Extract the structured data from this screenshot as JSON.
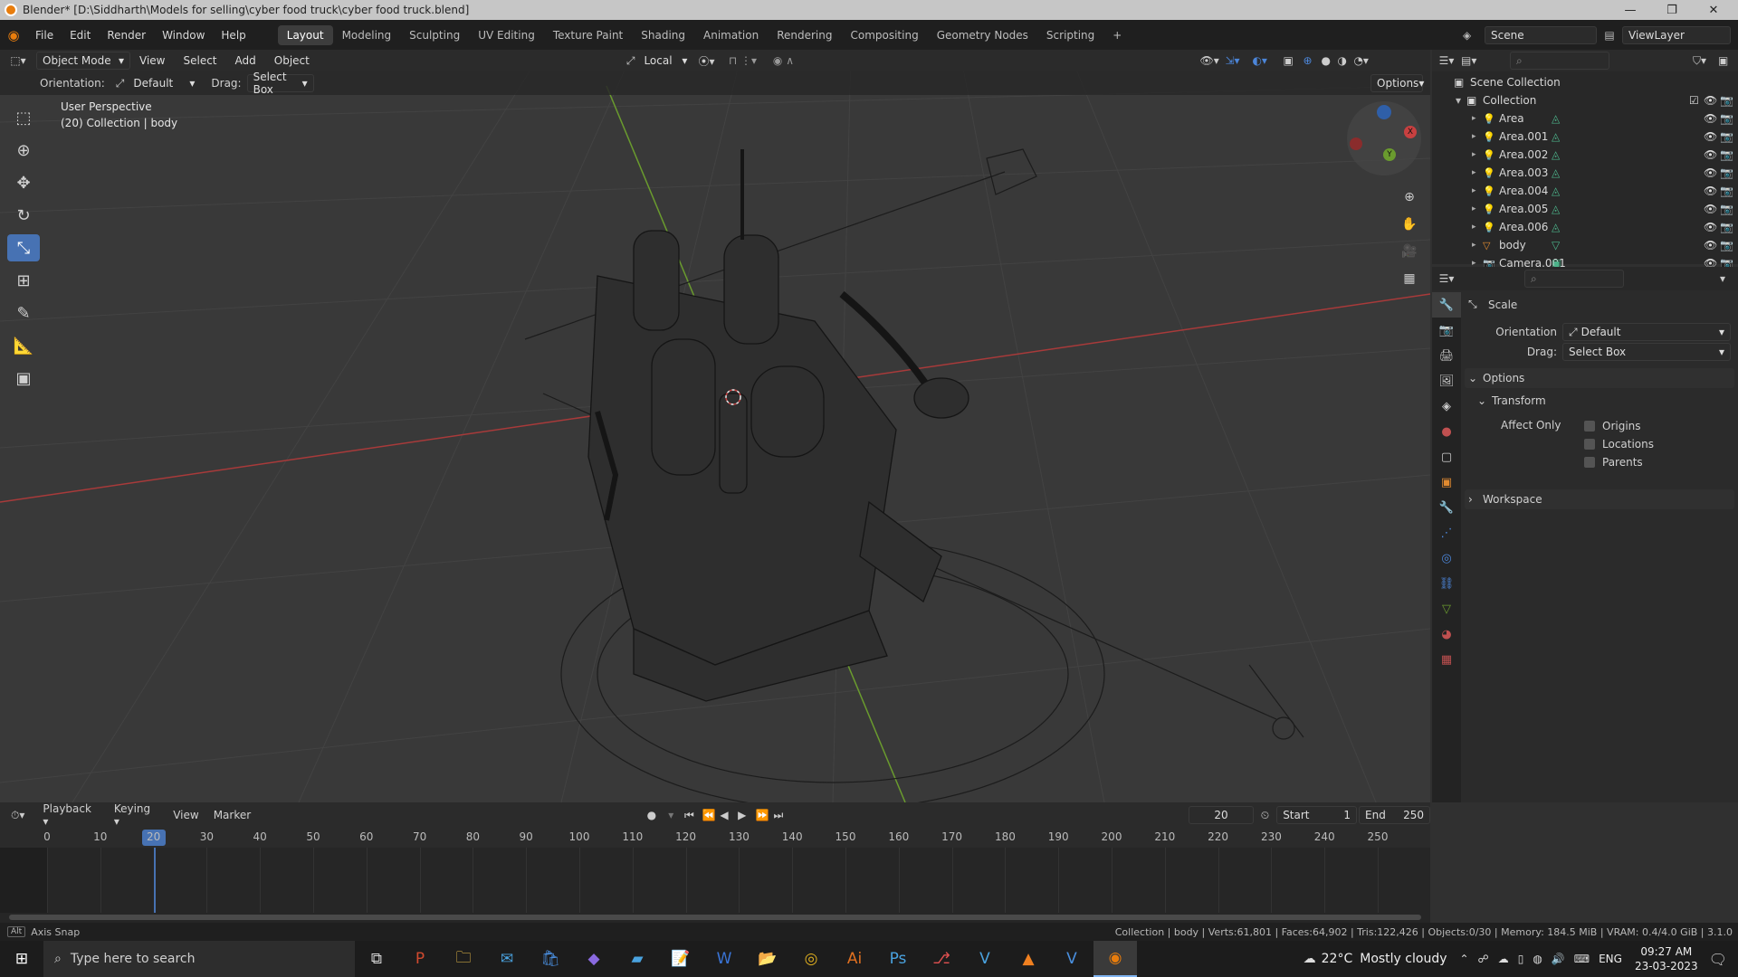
{
  "window": {
    "title": "Blender* [D:\\Siddharth\\Models for selling\\cyber food truck\\cyber food truck.blend]",
    "minimize": "—",
    "restore": "❐",
    "close": "✕"
  },
  "menu": [
    "File",
    "Edit",
    "Render",
    "Window",
    "Help"
  ],
  "workspaces": [
    "Layout",
    "Modeling",
    "Sculpting",
    "UV Editing",
    "Texture Paint",
    "Shading",
    "Animation",
    "Rendering",
    "Compositing",
    "Geometry Nodes",
    "Scripting",
    "+"
  ],
  "scene": {
    "name": "Scene",
    "view_layer": "ViewLayer"
  },
  "viewport_header": {
    "mode": "Object Mode",
    "menus": [
      "View",
      "Select",
      "Add",
      "Object"
    ],
    "transform_space": "Local",
    "options_label": "Options"
  },
  "tool_settings": {
    "orientation_label": "Orientation:",
    "orientation_value": "Default",
    "drag_label": "Drag:",
    "drag_value": "Select Box"
  },
  "hud": {
    "line1": "User Perspective",
    "line2": "(20) Collection | body"
  },
  "outliner": {
    "root": "Scene Collection",
    "collection": "Collection",
    "items": [
      {
        "name": "Area",
        "type": "light"
      },
      {
        "name": "Area.001",
        "type": "light"
      },
      {
        "name": "Area.002",
        "type": "light"
      },
      {
        "name": "Area.003",
        "type": "light"
      },
      {
        "name": "Area.004",
        "type": "light"
      },
      {
        "name": "Area.005",
        "type": "light"
      },
      {
        "name": "Area.006",
        "type": "light"
      },
      {
        "name": "body",
        "type": "mesh"
      },
      {
        "name": "Camera.001",
        "type": "camera"
      }
    ]
  },
  "properties": {
    "tool_name": "Scale",
    "orientation_label": "Orientation",
    "orientation_value": "Default",
    "drag_label": "Drag:",
    "drag_value": "Select Box",
    "options_panel": "Options",
    "transform_panel": "Transform",
    "affect_only_label": "Affect Only",
    "affect_only": [
      {
        "label": "Origins",
        "checked": false
      },
      {
        "label": "Locations",
        "checked": false
      },
      {
        "label": "Parents",
        "checked": false
      }
    ],
    "workspace_panel": "Workspace"
  },
  "timeline": {
    "menus": [
      "Playback",
      "Keying",
      "View",
      "Marker"
    ],
    "current_frame": "20",
    "start_label": "Start",
    "start": "1",
    "end_label": "End",
    "end": "250",
    "ruler": [
      "0",
      "10",
      "20",
      "30",
      "40",
      "50",
      "60",
      "70",
      "80",
      "90",
      "100",
      "110",
      "120",
      "130",
      "140",
      "150",
      "160",
      "170",
      "180",
      "190",
      "200",
      "210",
      "220",
      "230",
      "240",
      "250"
    ]
  },
  "statusbar": {
    "key_hint": "Alt",
    "left": "Axis Snap",
    "right": "Collection | body | Verts:61,801 | Faces:64,902 | Tris:122,426 | Objects:0/30 | Memory: 184.5 MiB | VRAM: 0.4/4.0 GiB | 3.1.0"
  },
  "taskbar": {
    "search_placeholder": "Type here to search",
    "weather_temp": "22°C",
    "weather_text": "Mostly cloudy",
    "language": "ENG",
    "time": "09:27 AM",
    "date": "23-03-2023"
  },
  "colors": {
    "accent": "#4772b3",
    "x_axis": "#a83a3a",
    "y_axis": "#6a9b2e",
    "active_frame": "#4772b3",
    "blender_orange": "#e87d0d"
  }
}
